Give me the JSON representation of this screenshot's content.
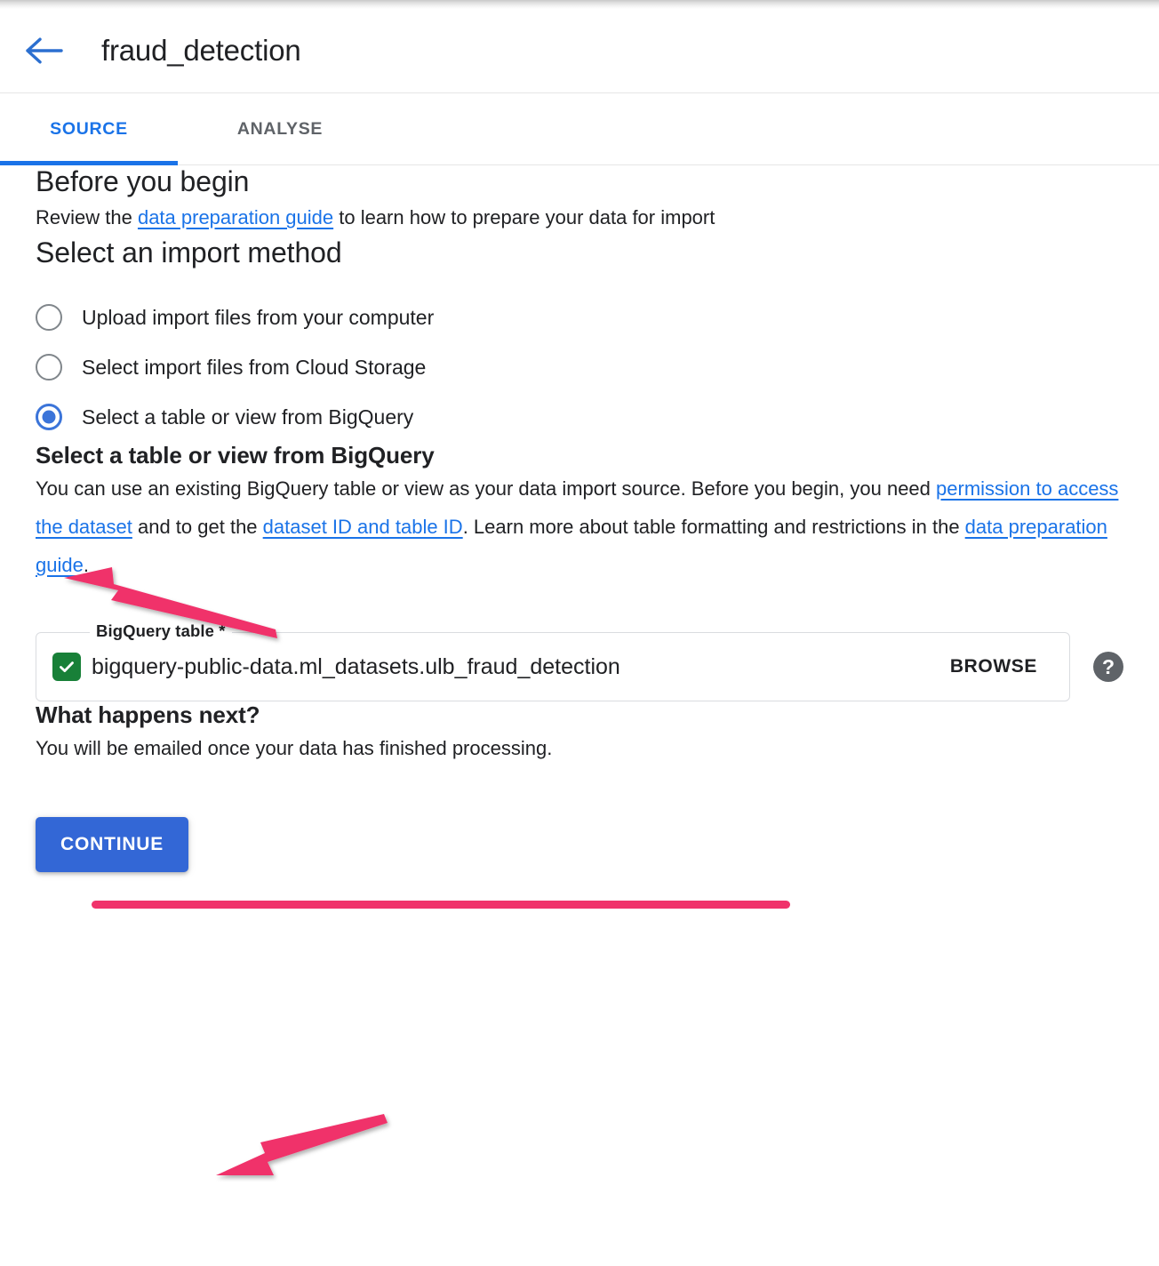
{
  "header": {
    "back_icon": "back-arrow-icon",
    "title": "fraud_detection"
  },
  "tabs": [
    {
      "label": "SOURCE",
      "active": true
    },
    {
      "label": "ANALYSE",
      "active": false
    }
  ],
  "before_you_begin": {
    "heading": "Before you begin",
    "text_before_link": "Review the ",
    "link": "data preparation guide",
    "text_after_link": " to learn how to prepare your data for import"
  },
  "import_method": {
    "heading": "Select an import method",
    "options": [
      {
        "label": "Upload import files from your computer",
        "selected": false
      },
      {
        "label": "Select import files from Cloud Storage",
        "selected": false
      },
      {
        "label": "Select a table or view from BigQuery",
        "selected": true
      }
    ]
  },
  "bigquery_section": {
    "heading": "Select a table or view from BigQuery",
    "para_1": "You can use an existing BigQuery table or view as your data import source. Before you begin, you need ",
    "link_1": "permission to access the dataset",
    "para_2": " and to get the ",
    "link_2": "dataset ID and table ID",
    "para_3": ". Learn more about table formatting and restrictions in the ",
    "link_3": "data preparation guide",
    "para_4": "."
  },
  "bigquery_field": {
    "label": "BigQuery table *",
    "value": "bigquery-public-data.ml_datasets.ulb_fraud_detection",
    "placeholder": "BigQuery table",
    "valid_icon": "check-icon",
    "browse_label": "BROWSE",
    "help_icon": "help-icon",
    "help_glyph": "?"
  },
  "what_next": {
    "heading": "What happens next?",
    "text": "You will be emailed once your data has finished processing."
  },
  "actions": {
    "continue_label": "CONTINUE"
  },
  "annotations": {
    "color": "#f0336b",
    "arrow_to_radio": "annotation-arrow-radio",
    "arrow_to_continue": "annotation-arrow-continue",
    "underline_field_value": "annotation-underline-table-id"
  },
  "colors": {
    "accent_blue": "#1a73e8",
    "button_blue": "#3367d6",
    "radio_blue": "#3b74d9",
    "valid_green": "#188038",
    "help_gray": "#5f6368",
    "annotation_pink": "#f0336b",
    "text_primary": "#202124",
    "border_gray": "#dadce0"
  }
}
